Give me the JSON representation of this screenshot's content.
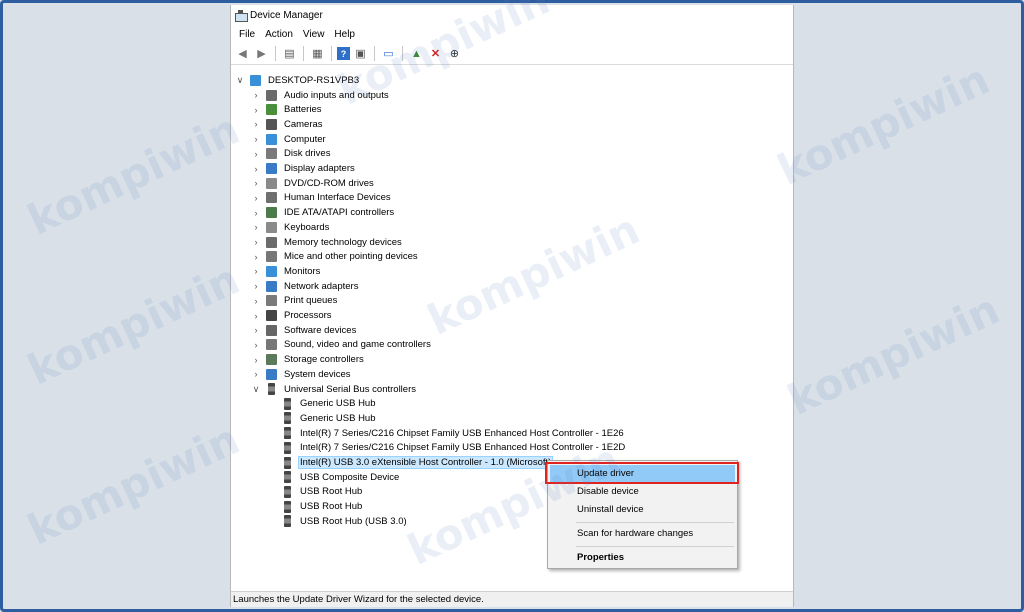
{
  "window": {
    "title": "Device Manager"
  },
  "menu": [
    "File",
    "Action",
    "View",
    "Help"
  ],
  "toolbar_icons": [
    "back-icon",
    "forward-icon",
    "properties-icon",
    "view-icon",
    "help-icon",
    "show-icon",
    "monitor-icon",
    "update-driver-icon",
    "uninstall-icon",
    "download-icon"
  ],
  "tree": {
    "root": "DESKTOP-RS1VPB3",
    "categories": [
      {
        "label": "Audio inputs and outputs",
        "color": "#6b6b6b"
      },
      {
        "label": "Batteries",
        "color": "#4a8f3c"
      },
      {
        "label": "Cameras",
        "color": "#555555"
      },
      {
        "label": "Computer",
        "color": "#3a8fd9"
      },
      {
        "label": "Disk drives",
        "color": "#7a7a7a"
      },
      {
        "label": "Display adapters",
        "color": "#3a7bc8"
      },
      {
        "label": "DVD/CD-ROM drives",
        "color": "#8a8a8a"
      },
      {
        "label": "Human Interface Devices",
        "color": "#6f6f6f"
      },
      {
        "label": "IDE ATA/ATAPI controllers",
        "color": "#4b7a4b"
      },
      {
        "label": "Keyboards",
        "color": "#8a8a8a"
      },
      {
        "label": "Memory technology devices",
        "color": "#6b6b6b"
      },
      {
        "label": "Mice and other pointing devices",
        "color": "#777777"
      },
      {
        "label": "Monitors",
        "color": "#3a8fd9"
      },
      {
        "label": "Network adapters",
        "color": "#3a7bc8"
      },
      {
        "label": "Print queues",
        "color": "#7a7a7a"
      },
      {
        "label": "Processors",
        "color": "#444444"
      },
      {
        "label": "Software devices",
        "color": "#666666"
      },
      {
        "label": "Sound, video and game controllers",
        "color": "#777777"
      },
      {
        "label": "Storage controllers",
        "color": "#5b7a5b"
      },
      {
        "label": "System devices",
        "color": "#3a7bc8"
      },
      {
        "label": "Universal Serial Bus controllers",
        "color": "#555555"
      }
    ],
    "usb_children": [
      "Generic USB Hub",
      "Generic USB Hub",
      "Intel(R) 7 Series/C216 Chipset Family USB Enhanced Host Controller - 1E26",
      "Intel(R) 7 Series/C216 Chipset Family USB Enhanced Host Controller - 1E2D",
      "Intel(R) USB 3.0 eXtensible Host Controller - 1.0 (Microsoft)",
      "USB Composite Device",
      "USB Root Hub",
      "USB Root Hub",
      "USB Root Hub (USB 3.0)"
    ],
    "selected_index": 4
  },
  "context_menu": {
    "update": "Update driver",
    "disable": "Disable device",
    "uninstall": "Uninstall device",
    "scan": "Scan for hardware changes",
    "properties": "Properties"
  },
  "status": "Launches the Update Driver Wizard for the selected device.",
  "watermark": "kompiwin"
}
